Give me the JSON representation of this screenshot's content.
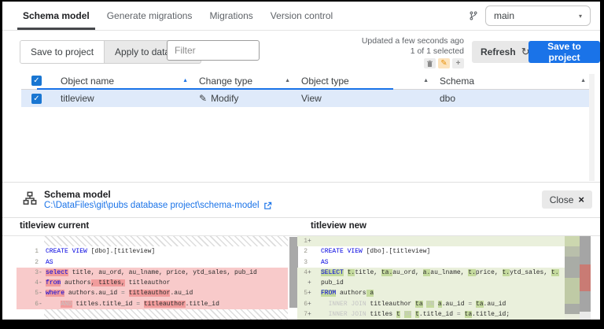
{
  "tabs": {
    "items": [
      {
        "label": "Schema model",
        "active": true
      },
      {
        "label": "Generate migrations",
        "active": false
      },
      {
        "label": "Migrations",
        "active": false
      },
      {
        "label": "Version control",
        "active": false
      }
    ]
  },
  "branch": {
    "selected": "main"
  },
  "toolbar": {
    "segments": [
      {
        "label": "Save to project",
        "active": true
      },
      {
        "label": "Apply to database",
        "active": false
      }
    ],
    "filter_placeholder": "Filter",
    "updated_text": "Updated a few seconds ago",
    "selection_text": "1 of 1 selected",
    "change_summary": [
      {
        "icon": "delete-icon",
        "active": false
      },
      {
        "icon": "edit-icon",
        "active": true
      },
      {
        "icon": "add-icon",
        "active": false
      }
    ],
    "refresh_label": "Refresh",
    "save_label": "Save to project"
  },
  "table": {
    "columns": [
      {
        "label": "Object name",
        "sort_active": true
      },
      {
        "label": "Change type",
        "sort_active": false
      },
      {
        "label": "Object type",
        "sort_active": false
      },
      {
        "label": "Schema",
        "sort_active": false
      }
    ],
    "rows": [
      {
        "checked": true,
        "object_name": "titleview",
        "change_type": "Modify",
        "object_type": "View",
        "schema": "dbo",
        "selected": true
      }
    ]
  },
  "panel": {
    "title": "Schema model",
    "path": "C:\\DataFiles\\git\\pubs database project\\schema-model",
    "close_label": "Close"
  },
  "diff": {
    "left": {
      "title": "titleview current",
      "lines": [
        {
          "type": "hatch"
        },
        {
          "num": "1",
          "mark": "",
          "type": "ctx",
          "segs": [
            {
              "t": "CREATE VIEW",
              "c": "kw"
            },
            {
              "t": " [dbo].[titleview]",
              "c": "txt"
            }
          ]
        },
        {
          "num": "2",
          "mark": "",
          "type": "ctx",
          "segs": [
            {
              "t": "AS",
              "c": "kw"
            }
          ]
        },
        {
          "num": "3",
          "mark": "-",
          "type": "rem",
          "segs": [
            {
              "t": "select",
              "c": "kw",
              "h": 1
            },
            {
              "t": " title, au_ord, au_lname, price, ytd_sales, pub_id",
              "c": "txt"
            }
          ]
        },
        {
          "num": "4",
          "mark": "-",
          "type": "rem",
          "segs": [
            {
              "t": "from",
              "c": "kw",
              "h": 1
            },
            {
              "t": " authors",
              "c": "txt"
            },
            {
              "t": ", titles,",
              "c": "txt",
              "h": 1
            },
            {
              "t": " titleauthor",
              "c": "txt"
            }
          ]
        },
        {
          "num": "5",
          "mark": "-",
          "type": "rem",
          "segs": [
            {
              "t": "where",
              "c": "kw",
              "h": 1
            },
            {
              "t": " authors.au_id ",
              "c": "txt"
            },
            {
              "t": "=",
              "c": "op"
            },
            {
              "t": " ",
              "c": "txt"
            },
            {
              "t": "titleauthor",
              "c": "txt",
              "h": 1
            },
            {
              "t": ".au_id",
              "c": "txt"
            }
          ]
        },
        {
          "num": "6",
          "mark": "-",
          "type": "rem",
          "segs": [
            {
              "t": "    ",
              "c": "txt"
            },
            {
              "t": "AND",
              "c": "dim",
              "h": 1
            },
            {
              "t": " titles.title_id ",
              "c": "txt"
            },
            {
              "t": "=",
              "c": "op"
            },
            {
              "t": " ",
              "c": "txt"
            },
            {
              "t": "titleauthor",
              "c": "txt",
              "h": 1
            },
            {
              "t": ".title_id",
              "c": "txt"
            }
          ]
        },
        {
          "type": "hatch"
        }
      ]
    },
    "right": {
      "title": "titleview new",
      "lines": [
        {
          "num": "1",
          "mark": "+",
          "type": "add",
          "segs": []
        },
        {
          "num": "2",
          "mark": "",
          "type": "ctx",
          "segs": [
            {
              "t": "CREATE VIEW",
              "c": "kw"
            },
            {
              "t": " [dbo].[titleview]",
              "c": "txt"
            }
          ]
        },
        {
          "num": "3",
          "mark": "",
          "type": "ctx",
          "segs": [
            {
              "t": "AS",
              "c": "kw"
            }
          ]
        },
        {
          "num": "4",
          "mark": "+",
          "type": "add",
          "segs": [
            {
              "t": "SELECT",
              "c": "kw",
              "h": 1
            },
            {
              "t": " ",
              "c": "txt"
            },
            {
              "t": "t.",
              "c": "txt",
              "h": 1
            },
            {
              "t": "title, ",
              "c": "txt"
            },
            {
              "t": "ta.",
              "c": "txt",
              "h": 1
            },
            {
              "t": "au_ord, ",
              "c": "txt"
            },
            {
              "t": "a.",
              "c": "txt",
              "h": 1
            },
            {
              "t": "au_lname, ",
              "c": "txt"
            },
            {
              "t": "t.",
              "c": "txt",
              "h": 1
            },
            {
              "t": "price, ",
              "c": "txt"
            },
            {
              "t": "t.",
              "c": "txt",
              "h": 1
            },
            {
              "t": "ytd_sales, ",
              "c": "txt"
            },
            {
              "t": "t.",
              "c": "txt",
              "h": 1
            }
          ]
        },
        {
          "num": "",
          "mark": "+",
          "type": "add",
          "segs": [
            {
              "t": "pub_id",
              "c": "txt"
            }
          ]
        },
        {
          "num": "5",
          "mark": "+",
          "type": "add",
          "segs": [
            {
              "t": "FROM",
              "c": "kw",
              "h": 1
            },
            {
              "t": " authors",
              "c": "txt"
            },
            {
              "t": " a",
              "c": "txt",
              "h": 1
            }
          ]
        },
        {
          "num": "6",
          "mark": "+",
          "type": "add",
          "segs": [
            {
              "t": "  ",
              "c": "txt"
            },
            {
              "t": "INNER JOIN",
              "c": "dim"
            },
            {
              "t": " titleauthor ",
              "c": "txt"
            },
            {
              "t": "ta",
              "c": "txt",
              "h": 1
            },
            {
              "t": " ",
              "c": "txt"
            },
            {
              "t": "ON",
              "c": "dim",
              "h": 1
            },
            {
              "t": " ",
              "c": "txt"
            },
            {
              "t": "a",
              "c": "txt",
              "h": 1
            },
            {
              "t": ".au_id ",
              "c": "txt"
            },
            {
              "t": "=",
              "c": "op"
            },
            {
              "t": " ",
              "c": "txt"
            },
            {
              "t": "ta",
              "c": "txt",
              "h": 1
            },
            {
              "t": ".au_id",
              "c": "txt"
            }
          ]
        },
        {
          "num": "7",
          "mark": "+",
          "type": "add",
          "segs": [
            {
              "t": "  ",
              "c": "txt"
            },
            {
              "t": "INNER JOIN",
              "c": "dim"
            },
            {
              "t": " titles ",
              "c": "txt"
            },
            {
              "t": "t",
              "c": "txt",
              "h": 1
            },
            {
              "t": " ",
              "c": "txt"
            },
            {
              "t": "ON",
              "c": "dim",
              "h": 1
            },
            {
              "t": " ",
              "c": "txt"
            },
            {
              "t": "t",
              "c": "txt",
              "h": 1
            },
            {
              "t": ".title_id ",
              "c": "txt"
            },
            {
              "t": "=",
              "c": "op"
            },
            {
              "t": " ",
              "c": "txt"
            },
            {
              "t": "ta",
              "c": "txt",
              "h": 1
            },
            {
              "t": ".title_id;",
              "c": "txt"
            }
          ]
        }
      ]
    }
  },
  "colors": {
    "accent": "#1a73e8",
    "checkbox_blue": "#1976d2",
    "selected_row": "#dfeafa",
    "removed_line_bg": "#f8caca",
    "removed_inline_bg": "#f19c9c",
    "added_line_bg": "#eaf0dc",
    "added_inline_bg": "#c4da9d",
    "keyword_blue": "#0000e0",
    "modify_orange": "#e8920d"
  }
}
